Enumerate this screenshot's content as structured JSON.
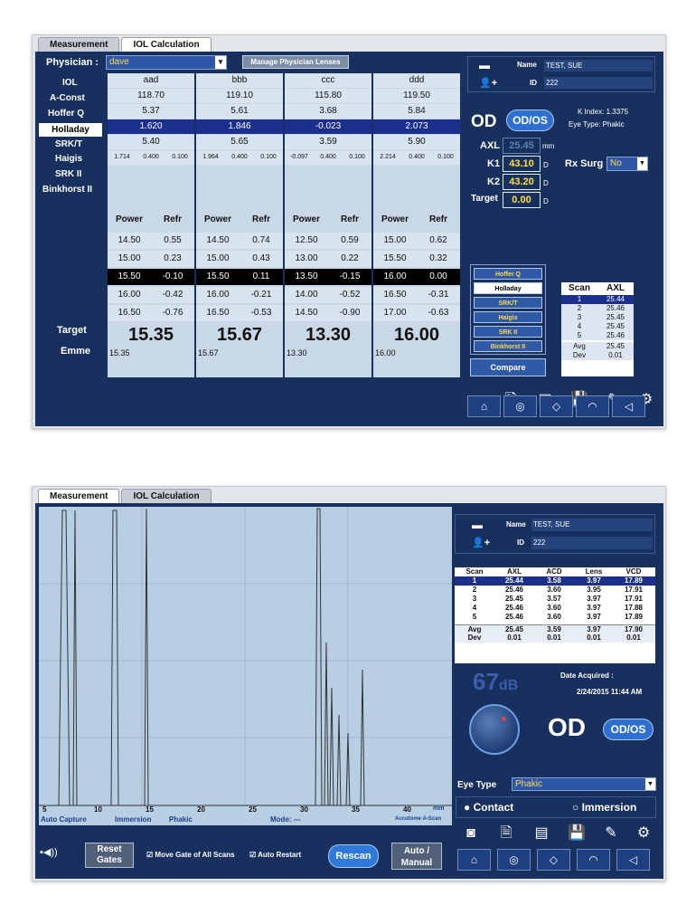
{
  "top": {
    "tabs": [
      "Measurement",
      "IOL Calculation"
    ],
    "physician_label": "Physician :",
    "physician_value": "dave",
    "manage_button": "Manage Physician Lenses",
    "row_labels": [
      "IOL",
      "A-Const",
      "Hoffer Q",
      "Holladay",
      "SRK/T",
      "Haigis",
      "SRK II",
      "Binkhorst II"
    ],
    "lenses": [
      {
        "name": "aad",
        "a_const": "118.70",
        "hoffer_q": "5.37",
        "holladay": "1.620",
        "srkt": "5.40",
        "haigis": [
          "1.714",
          "0.400",
          "0.100"
        ],
        "rows": [
          [
            "14.50",
            "0.55"
          ],
          [
            "15.00",
            "0.23"
          ],
          [
            "15.50",
            "-0.10"
          ],
          [
            "16.00",
            "-0.42"
          ],
          [
            "16.50",
            "-0.76"
          ]
        ],
        "target": "15.35",
        "emme": "15.35"
      },
      {
        "name": "bbb",
        "a_const": "119.10",
        "hoffer_q": "5.61",
        "holladay": "1.846",
        "srkt": "5.65",
        "haigis": [
          "1.964",
          "0.400",
          "0.100"
        ],
        "rows": [
          [
            "14.50",
            "0.74"
          ],
          [
            "15.00",
            "0.43"
          ],
          [
            "15.50",
            "0.11"
          ],
          [
            "16.00",
            "-0.21"
          ],
          [
            "16.50",
            "-0.53"
          ]
        ],
        "target": "15.67",
        "emme": "15.67"
      },
      {
        "name": "ccc",
        "a_const": "115.80",
        "hoffer_q": "3.68",
        "holladay": "-0.023",
        "srkt": "3.59",
        "haigis": [
          "-0.097",
          "0.400",
          "0.100"
        ],
        "rows": [
          [
            "12.50",
            "0.59"
          ],
          [
            "13.00",
            "0.22"
          ],
          [
            "13.50",
            "-0.15"
          ],
          [
            "14.00",
            "-0.52"
          ],
          [
            "14.50",
            "-0.90"
          ]
        ],
        "target": "13.30",
        "emme": "13.30"
      },
      {
        "name": "ddd",
        "a_const": "119.50",
        "hoffer_q": "5.84",
        "holladay": "2.073",
        "srkt": "5.90",
        "haigis": [
          "2.214",
          "0.400",
          "0.100"
        ],
        "rows": [
          [
            "15.00",
            "0.62"
          ],
          [
            "15.50",
            "0.32"
          ],
          [
            "16.00",
            "0.00"
          ],
          [
            "16.50",
            "-0.31"
          ],
          [
            "17.00",
            "-0.63"
          ]
        ],
        "target": "16.00",
        "emme": "16.00"
      }
    ],
    "power_label": "Power",
    "refr_label": "Refr",
    "target_label": "Target",
    "emme_label": "Emme",
    "name_label": "Name",
    "name_value": "TEST, SUE",
    "id_label": "ID",
    "id_value": "222",
    "od": "OD",
    "odos": "OD/OS",
    "k_index": "K Index: 1.3375",
    "eye_type_text": "Eye Type: Phakic",
    "axl_label": "AXL",
    "axl_value": "25.45",
    "mm": "mm",
    "k1_label": "K1",
    "k1_value": "43.10",
    "k2_label": "K2",
    "k2_value": "43.20",
    "d": "D",
    "target_label2": "Target",
    "target_value": "0.00",
    "rx_label": "Rx Surg",
    "rx_value": "No",
    "formulas": [
      "Hoffer Q",
      "Holladay",
      "SRK/T",
      "Haigis",
      "SRK II",
      "Binkhorst II"
    ],
    "compare": "Compare",
    "scan_header": [
      "Scan",
      "AXL"
    ],
    "scans": [
      [
        "1",
        "25.44"
      ],
      [
        "2",
        "25.46"
      ],
      [
        "3",
        "25.45"
      ],
      [
        "4",
        "25.45"
      ],
      [
        "5",
        "25.46"
      ]
    ],
    "avg": [
      "Avg",
      "25.45"
    ],
    "dev": [
      "Dev",
      "0.01"
    ]
  },
  "bottom": {
    "tabs": [
      "Measurement",
      "IOL Calculation"
    ],
    "x_ticks": [
      "5",
      "10",
      "15",
      "20",
      "25",
      "30",
      "35",
      "40"
    ],
    "unit_mm": "mm",
    "status": [
      "Auto Capture",
      "Immersion",
      "Phakic",
      "Mode: ---",
      "Accutome A-Scan"
    ],
    "reset_gates": "Reset Gates",
    "move_gate": "Move Gate of All Scans",
    "auto_restart": "Auto Restart",
    "rescan": "Rescan",
    "auto_manual": "Auto / Manual",
    "name_label": "Name",
    "name_value": "TEST, SUE",
    "id_label": "ID",
    "id_value": "222",
    "table_header": [
      "Scan",
      "AXL",
      "ACD",
      "Lens",
      "VCD"
    ],
    "table_rows": [
      [
        "1",
        "25.44",
        "3.58",
        "3.97",
        "17.89"
      ],
      [
        "2",
        "25.46",
        "3.60",
        "3.95",
        "17.91"
      ],
      [
        "3",
        "25.45",
        "3.57",
        "3.97",
        "17.91"
      ],
      [
        "4",
        "25.46",
        "3.60",
        "3.97",
        "17.88"
      ],
      [
        "5",
        "25.46",
        "3.60",
        "3.97",
        "17.89"
      ]
    ],
    "avg": [
      "Avg",
      "25.45",
      "3.59",
      "3.97",
      "17.90"
    ],
    "dev": [
      "Dev",
      "0.01",
      "0.01",
      "0.01",
      "0.01"
    ],
    "gain": "67",
    "db": "dB",
    "date_label": "Date Acquired :",
    "date_value": "2/24/2015 11:44 AM",
    "od": "OD",
    "odos": "OD/OS",
    "eye_type_label": "Eye Type",
    "eye_type_value": "Phakic",
    "contact": "Contact",
    "immersion": "Immersion"
  }
}
